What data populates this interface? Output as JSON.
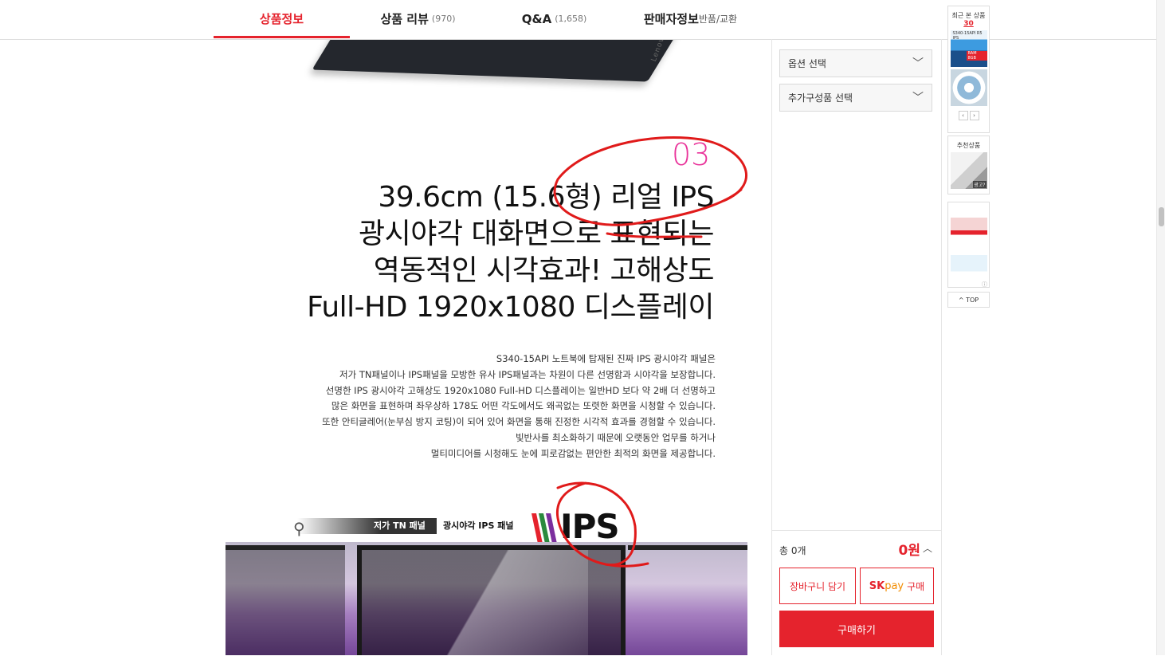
{
  "tabs": [
    {
      "label": "상품정보",
      "count": "",
      "sub": ""
    },
    {
      "label": "상품 리뷰",
      "count": "(970)",
      "sub": ""
    },
    {
      "label": "Q&A",
      "count": "(1,658)",
      "sub": ""
    },
    {
      "label": "판매자정보",
      "count": "",
      "sub": "반품/교환"
    }
  ],
  "content": {
    "laptop_logo": "Lenovo",
    "section_number": "03",
    "headline": [
      "39.6cm (15.6형) 리얼 IPS",
      "광시야각 대화면으로 표현되는",
      "역동적인 시각효과! 고해상도",
      "Full-HD 1920x1080 디스플레이"
    ],
    "body": [
      "S340-15API 노트북에 탑재된 진짜 IPS 광시야각 패널은",
      "저가 TN패널이나 IPS패널을 모방한 유사 IPS패널과는 차원이 다른 선명함과 시야각을 보장합니다.",
      "선명한 IPS 광시야각 고해상도 1920x1080 Full-HD 디스플레이는 일반HD 보다 약 2배 더 선명하고",
      "많은 화면을 표현하며 좌우상하 178도 어떤 각도에서도 왜곡없는 또렷한 화면을 시청할 수 있습니다.",
      "또한 안티글레어(눈부심 방지 코팅)이 되어 있어 화면을 통해 진정한 시각적 효과를 경험할 수 있습니다.",
      "빛반사를 최소화하기 때문에 오랫동안 업무를 하거나",
      "멀티미디어를 시청해도 눈에 피로감없는 편안한 최적의 화면을 제공합니다."
    ],
    "compare": {
      "tn_label": "저가 TN 패널",
      "ips_label": "광시야각 IPS 패널",
      "ips_logo": "IPS"
    }
  },
  "options": {
    "option_select": "옵션 선택",
    "addon_select": "추가구성품 선택",
    "total_label": "총 0개",
    "total_price": "0원",
    "cart_button": "장바구니 담기",
    "skpay_brand_sk": "SK",
    "skpay_brand_pay": "pay",
    "skpay_button": "구매",
    "buy_button": "구매하기"
  },
  "rail": {
    "recent_title": "최근 본 상품",
    "recent_count": "30",
    "thumb1_text": "S340-15API R5 IPS",
    "thumb1_badge": "RAM 8GB",
    "recommend_title": "추천상품",
    "recommend_badge": "광고?",
    "top_label": "TOP"
  },
  "colors": {
    "accent": "#e5232d",
    "section_number": "#e9339a",
    "annotation": "#e01a1a"
  }
}
